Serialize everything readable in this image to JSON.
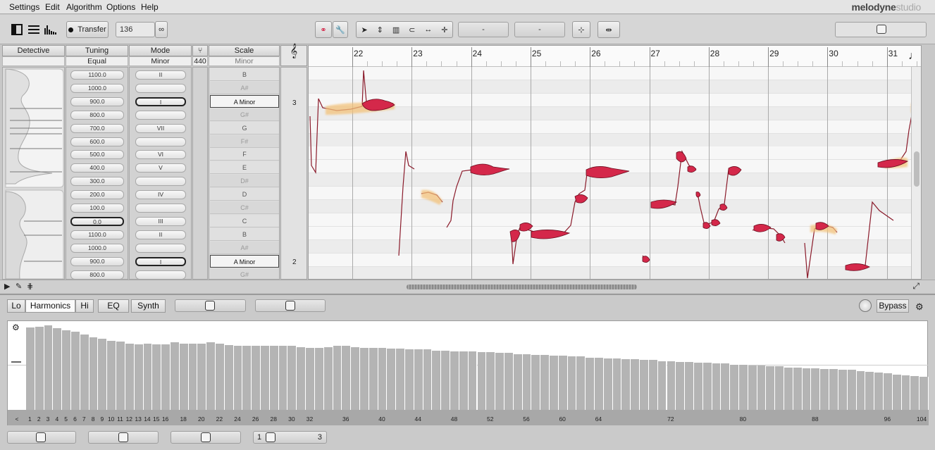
{
  "menu": [
    "Settings",
    "Edit",
    "Algorithm",
    "Options",
    "Help"
  ],
  "brand": {
    "name": "melodyne",
    "edition": "studio"
  },
  "toolbar": {
    "transfer_label": "Transfer",
    "tempo": "136",
    "field1": "-",
    "field2": "-"
  },
  "headers": {
    "detective": "Detective",
    "tuning": "Tuning",
    "mode": "Mode",
    "scale": "Scale",
    "tuning_value": "Equal Temperam...",
    "mode_value": "Minor",
    "pitch_ref": "440",
    "scale_value": "Minor"
  },
  "tuning_cells": [
    "1100.0",
    "1000.0",
    "900.0",
    "800.0",
    "700.0",
    "600.0",
    "500.0",
    "400.0",
    "300.0",
    "200.0",
    "100.0",
    "0.0",
    "1100.0",
    "1000.0",
    "900.0",
    "800.0"
  ],
  "mode_cells": [
    "II",
    "",
    "I",
    "",
    "VII",
    "",
    "VI",
    "V",
    "",
    "IV",
    "",
    "III",
    "II",
    "",
    "I",
    ""
  ],
  "scale_cells": [
    "B",
    "A#",
    "A Minor",
    "G#",
    "G",
    "F#",
    "F",
    "E",
    "D#",
    "D",
    "C#",
    "C",
    "B",
    "A#",
    "A Minor",
    "G#"
  ],
  "octave_markers": [
    "3",
    "2"
  ],
  "bars": [
    "22",
    "23",
    "24",
    "25",
    "26",
    "27",
    "28",
    "29",
    "30",
    "31"
  ],
  "editor": {
    "tabs": [
      "Lo",
      "Harmonics",
      "Hi",
      "EQ",
      "Synth"
    ],
    "bypass_label": "Bypass",
    "harmonic_labels": [
      "<",
      "1",
      "2",
      "3",
      "4",
      "5",
      "6",
      "7",
      "8",
      "9",
      "10",
      "11",
      "12",
      "13",
      "14",
      "15",
      "16",
      "18",
      "20",
      "22",
      "24",
      "26",
      "28",
      "30",
      "32",
      "36",
      "40",
      "44",
      "48",
      "52",
      "56",
      "60",
      "64",
      "72",
      "80",
      "88",
      "96",
      "104"
    ],
    "harmonic_levels": [
      0.93,
      0.94,
      0.95,
      0.92,
      0.9,
      0.88,
      0.85,
      0.82,
      0.8,
      0.78,
      0.77,
      0.75,
      0.74,
      0.75,
      0.74,
      0.74,
      0.76,
      0.75,
      0.75,
      0.75,
      0.76,
      0.75,
      0.73,
      0.72,
      0.72,
      0.72,
      0.72,
      0.72,
      0.72,
      0.72,
      0.71,
      0.7,
      0.7,
      0.71,
      0.72,
      0.72,
      0.71,
      0.7,
      0.7,
      0.7,
      0.69,
      0.69,
      0.68,
      0.68,
      0.68,
      0.67,
      0.67,
      0.66,
      0.66,
      0.66,
      0.65,
      0.65,
      0.64,
      0.64,
      0.63,
      0.63,
      0.62,
      0.62,
      0.61,
      0.61,
      0.6,
      0.6,
      0.59,
      0.59,
      0.58,
      0.58,
      0.57,
      0.57,
      0.56,
      0.56,
      0.55,
      0.55,
      0.54,
      0.54,
      0.53,
      0.53,
      0.52,
      0.52,
      0.51,
      0.51,
      0.5,
      0.5,
      0.49,
      0.49,
      0.48,
      0.48,
      0.47,
      0.47,
      0.46,
      0.46,
      0.45,
      0.45,
      0.44,
      0.43,
      0.42,
      0.41,
      0.4,
      0.39,
      0.38,
      0.37
    ],
    "bottom_num1": "1",
    "bottom_num3": "3"
  },
  "colors": {
    "note_fill": "#d4284a",
    "note_edge": "#7a1024",
    "glow": "#f5c88a",
    "lane_light": "#f7f7f7",
    "lane_dark": "#ececec"
  }
}
